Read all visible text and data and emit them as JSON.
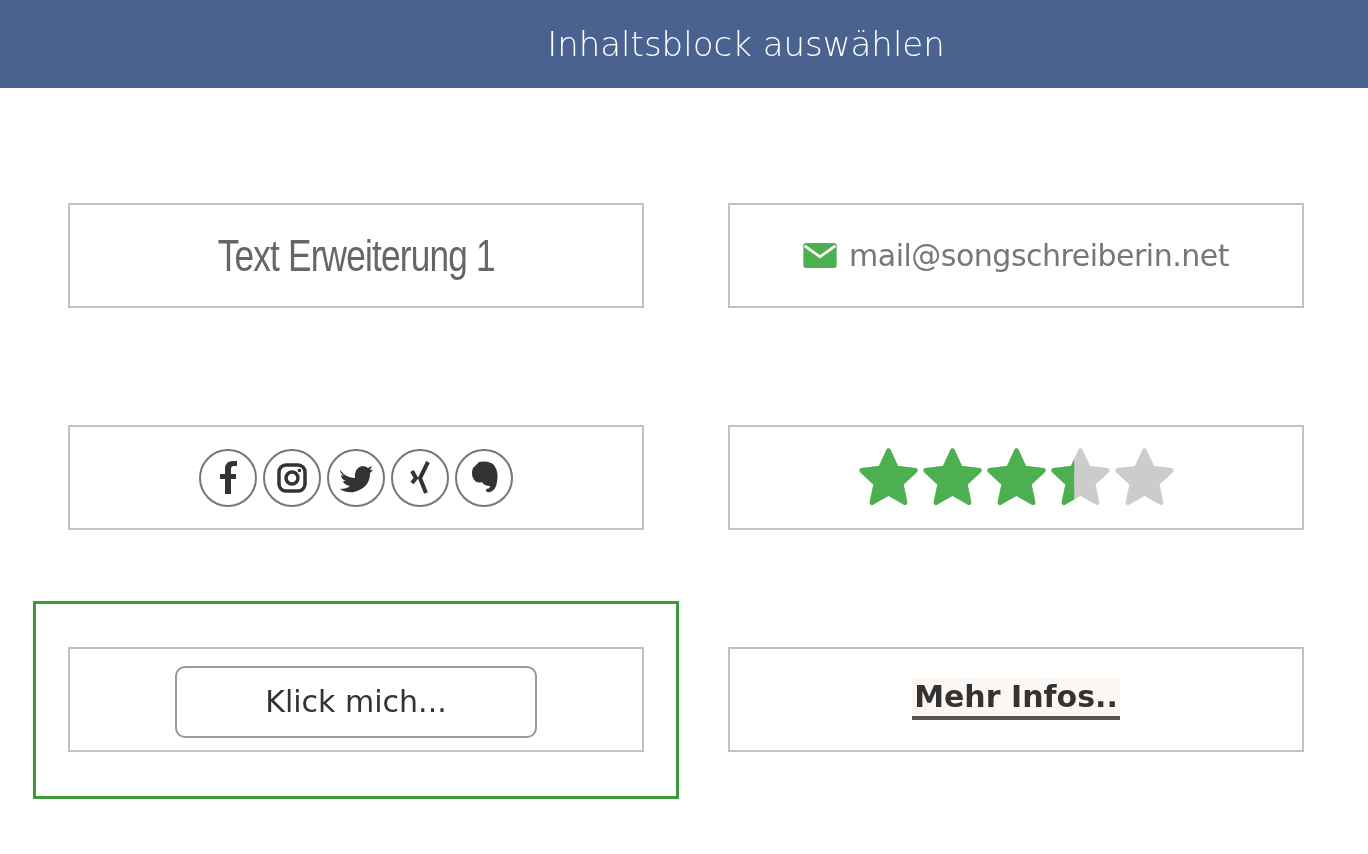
{
  "header": {
    "title": "Inhaltsblock auswählen"
  },
  "blocks": [
    {
      "kind": "heading",
      "text": "Text Erweiterung 1",
      "selected": false
    },
    {
      "kind": "email",
      "text": "mail@songschreiberin.net",
      "selected": false
    },
    {
      "kind": "social",
      "selected": false
    },
    {
      "kind": "rating",
      "stars": 3.4,
      "selected": false
    },
    {
      "kind": "button",
      "text": "Klick mich...",
      "selected": true
    },
    {
      "kind": "link",
      "text": "Mehr Infos..",
      "selected": false
    }
  ]
}
